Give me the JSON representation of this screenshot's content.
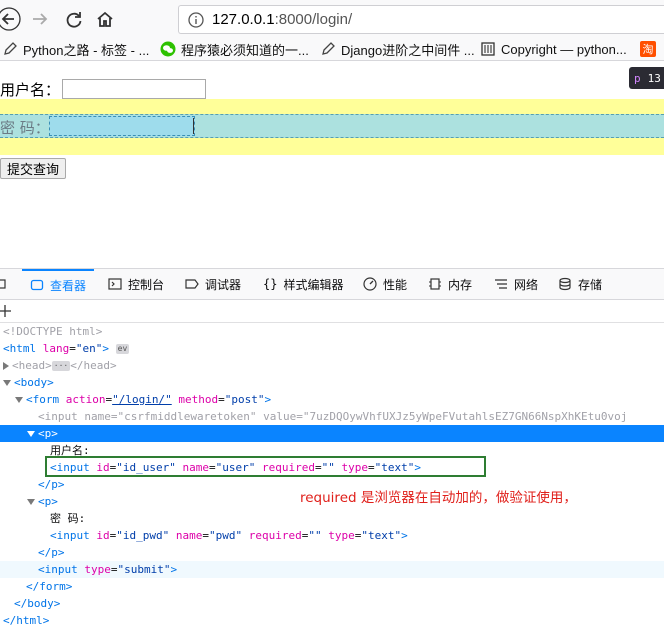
{
  "browser": {
    "url_host": "127.0.0.1",
    "url_rest": ":8000/login/",
    "bookmarks": [
      {
        "label": "Python之路 - 标签 - ...",
        "icon": "pencil-icon"
      },
      {
        "label": "程序猿必须知道的一...",
        "icon": "wechat-icon"
      },
      {
        "label": "Django进阶之中间件 ...",
        "icon": "pencil-icon"
      },
      {
        "label": "Copyright — python...",
        "icon": "book-icon"
      },
      {
        "label": "淘",
        "icon": "taobao-icon"
      }
    ]
  },
  "page": {
    "username_label": "用户名：",
    "password_label": "密 码：",
    "submit_label": "提交查询",
    "inspector_tip": {
      "tag": "p",
      "size": "13"
    }
  },
  "devtools": {
    "tabs": [
      {
        "label": "查看器",
        "icon": "inspector-icon",
        "selected": true
      },
      {
        "label": "控制台",
        "icon": "console-icon"
      },
      {
        "label": "调试器",
        "icon": "debugger-icon"
      },
      {
        "label": "样式编辑器",
        "icon": "style-editor-icon"
      },
      {
        "label": "性能",
        "icon": "performance-icon"
      },
      {
        "label": "内存",
        "icon": "memory-icon"
      },
      {
        "label": "网络",
        "icon": "network-icon"
      },
      {
        "label": "存储",
        "icon": "storage-icon"
      }
    ],
    "tree": {
      "doctype": "<!DOCTYPE html>",
      "html_open": "<html",
      "html_attr": "lang",
      "html_val": "\"en\"",
      "head": "<head>",
      "head_close": "</head>",
      "body_open": "<body>",
      "form_open": "<form",
      "form_action": "\"/login/\"",
      "form_method": "\"post\"",
      "csrf_line": "<input name=\"csrfmiddlewaretoken\" value=\"7uzDQOywVhfUXJz5yWpeFVutahlsEZ7GN66NspXhKEtu0voj",
      "p_open": "<p>",
      "username_text": "用户名:",
      "input_user": {
        "id": "\"id_user\"",
        "name": "\"user\"",
        "required": "\"\"",
        "type": "\"text\""
      },
      "p_close": "</p>",
      "password_text": "密 码:",
      "input_pwd": {
        "id": "\"id_pwd\"",
        "name": "\"pwd\"",
        "required": "\"\"",
        "type": "\"text\""
      },
      "submit_type": "\"submit\"",
      "form_close": "</form>",
      "body_close": "</body>",
      "html_close": "</html>"
    }
  },
  "annotation": "required 是浏览器在自动加的，做验证使用，"
}
